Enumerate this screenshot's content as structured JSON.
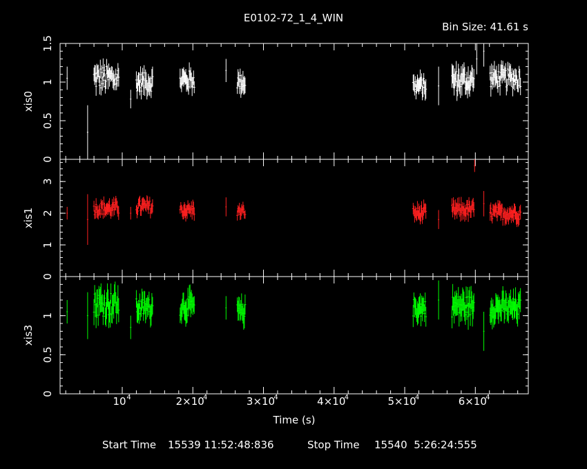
{
  "header": {
    "title": "E0102-72_1_4_WIN",
    "bin_size": "Bin Size: 41.61 s"
  },
  "footer": {
    "start_label": "Start Time",
    "start_value": "15539 11:52:48:836",
    "stop_label": "Stop Time",
    "stop_value": "15540  5:26:24:555"
  },
  "colors": {
    "background": "#000000",
    "axes": "#ffffff",
    "xis0": "#ffffff",
    "xis1": "#ff2020",
    "xis3": "#00ff00"
  },
  "chart_data": {
    "type": "scatter",
    "error_bars": true,
    "shared_x": {
      "label": "Time (s)",
      "lim": [
        1200,
        67500
      ],
      "ticks": [
        {
          "value": 10000,
          "label": "10",
          "exp": "4"
        },
        {
          "value": 20000,
          "label": "2×10",
          "exp": "4"
        },
        {
          "value": 30000,
          "label": "3×10",
          "exp": "4"
        },
        {
          "value": 40000,
          "label": "4×10",
          "exp": "4"
        },
        {
          "value": 50000,
          "label": "5×10",
          "exp": "4"
        },
        {
          "value": 60000,
          "label": "6×10",
          "exp": "4"
        }
      ]
    },
    "panels": [
      {
        "name": "xis0",
        "ylabel": "xis0",
        "color": "#ffffff",
        "ylim": [
          0,
          1.5
        ],
        "yticks": [
          {
            "value": 0,
            "label": "0"
          },
          {
            "value": 0.5,
            "label": "0.5"
          },
          {
            "value": 1,
            "label": "1"
          },
          {
            "value": 1.5,
            "label": "1.5"
          }
        ],
        "isolated": [
          [
            2200,
            1.05,
            0.15
          ],
          [
            5100,
            0.35,
            0.35
          ],
          [
            11200,
            0.78,
            0.12
          ],
          [
            24700,
            1.15,
            0.15
          ],
          [
            54800,
            0.95,
            0.25
          ],
          [
            60200,
            1.3,
            0.2
          ],
          [
            61200,
            1.4,
            0.2
          ]
        ],
        "segments": [
          {
            "start": 6000,
            "end": 9500,
            "base": 1.05,
            "amp": 0.16,
            "err": 0.1
          },
          {
            "start": 12000,
            "end": 14300,
            "base": 1.0,
            "amp": 0.12,
            "err": 0.1
          },
          {
            "start": 18200,
            "end": 20200,
            "base": 1.03,
            "amp": 0.12,
            "err": 0.1
          },
          {
            "start": 26300,
            "end": 27400,
            "base": 1.0,
            "amp": 0.1,
            "err": 0.1
          },
          {
            "start": 51200,
            "end": 53000,
            "base": 0.95,
            "amp": 0.1,
            "err": 0.1
          },
          {
            "start": 56700,
            "end": 59800,
            "base": 1.02,
            "amp": 0.14,
            "err": 0.12
          },
          {
            "start": 62100,
            "end": 66400,
            "base": 1.05,
            "amp": 0.12,
            "err": 0.1
          }
        ]
      },
      {
        "name": "xis1",
        "ylabel": "xis1",
        "color": "#ff2020",
        "ylim": [
          0,
          3.7
        ],
        "yticks": [
          {
            "value": 0,
            "label": "0"
          },
          {
            "value": 1,
            "label": "1"
          },
          {
            "value": 2,
            "label": "2"
          },
          {
            "value": 3,
            "label": "3"
          }
        ],
        "isolated": [
          [
            2200,
            2.0,
            0.2
          ],
          [
            5100,
            1.8,
            0.8
          ],
          [
            11200,
            2.0,
            0.2
          ],
          [
            24700,
            2.2,
            0.3
          ],
          [
            54800,
            1.8,
            0.3
          ],
          [
            59900,
            3.5,
            0.2
          ],
          [
            61200,
            2.3,
            0.4
          ]
        ],
        "segments": [
          {
            "start": 6000,
            "end": 9500,
            "base": 2.15,
            "amp": 0.2,
            "err": 0.18
          },
          {
            "start": 12000,
            "end": 14300,
            "base": 2.2,
            "amp": 0.2,
            "err": 0.18
          },
          {
            "start": 18200,
            "end": 20200,
            "base": 2.1,
            "amp": 0.18,
            "err": 0.18
          },
          {
            "start": 26300,
            "end": 27400,
            "base": 2.05,
            "amp": 0.15,
            "err": 0.15
          },
          {
            "start": 51200,
            "end": 53000,
            "base": 2.0,
            "amp": 0.18,
            "err": 0.2
          },
          {
            "start": 56700,
            "end": 59800,
            "base": 2.1,
            "amp": 0.2,
            "err": 0.2
          },
          {
            "start": 62100,
            "end": 66400,
            "base": 2.0,
            "amp": 0.2,
            "err": 0.2
          }
        ]
      },
      {
        "name": "xis3",
        "ylabel": "xis3",
        "color": "#00ff00",
        "ylim": [
          0,
          1.5
        ],
        "yticks": [
          {
            "value": 0,
            "label": "0"
          },
          {
            "value": 0.5,
            "label": "0.5"
          },
          {
            "value": 1,
            "label": "1"
          }
        ],
        "isolated": [
          [
            2200,
            1.05,
            0.15
          ],
          [
            5100,
            1.0,
            0.3
          ],
          [
            11200,
            0.85,
            0.15
          ],
          [
            24700,
            1.1,
            0.15
          ],
          [
            54800,
            1.2,
            0.25
          ],
          [
            61200,
            0.8,
            0.25
          ]
        ],
        "segments": [
          {
            "start": 6000,
            "end": 9500,
            "base": 1.15,
            "amp": 0.16,
            "err": 0.15
          },
          {
            "start": 12000,
            "end": 14300,
            "base": 1.1,
            "amp": 0.12,
            "err": 0.12
          },
          {
            "start": 18200,
            "end": 20200,
            "base": 1.12,
            "amp": 0.12,
            "err": 0.13
          },
          {
            "start": 26300,
            "end": 27400,
            "base": 1.05,
            "amp": 0.1,
            "err": 0.12
          },
          {
            "start": 51200,
            "end": 53000,
            "base": 1.1,
            "amp": 0.12,
            "err": 0.12
          },
          {
            "start": 56700,
            "end": 59800,
            "base": 1.12,
            "amp": 0.14,
            "err": 0.14
          },
          {
            "start": 62100,
            "end": 66400,
            "base": 1.1,
            "amp": 0.12,
            "err": 0.13
          }
        ]
      }
    ]
  }
}
